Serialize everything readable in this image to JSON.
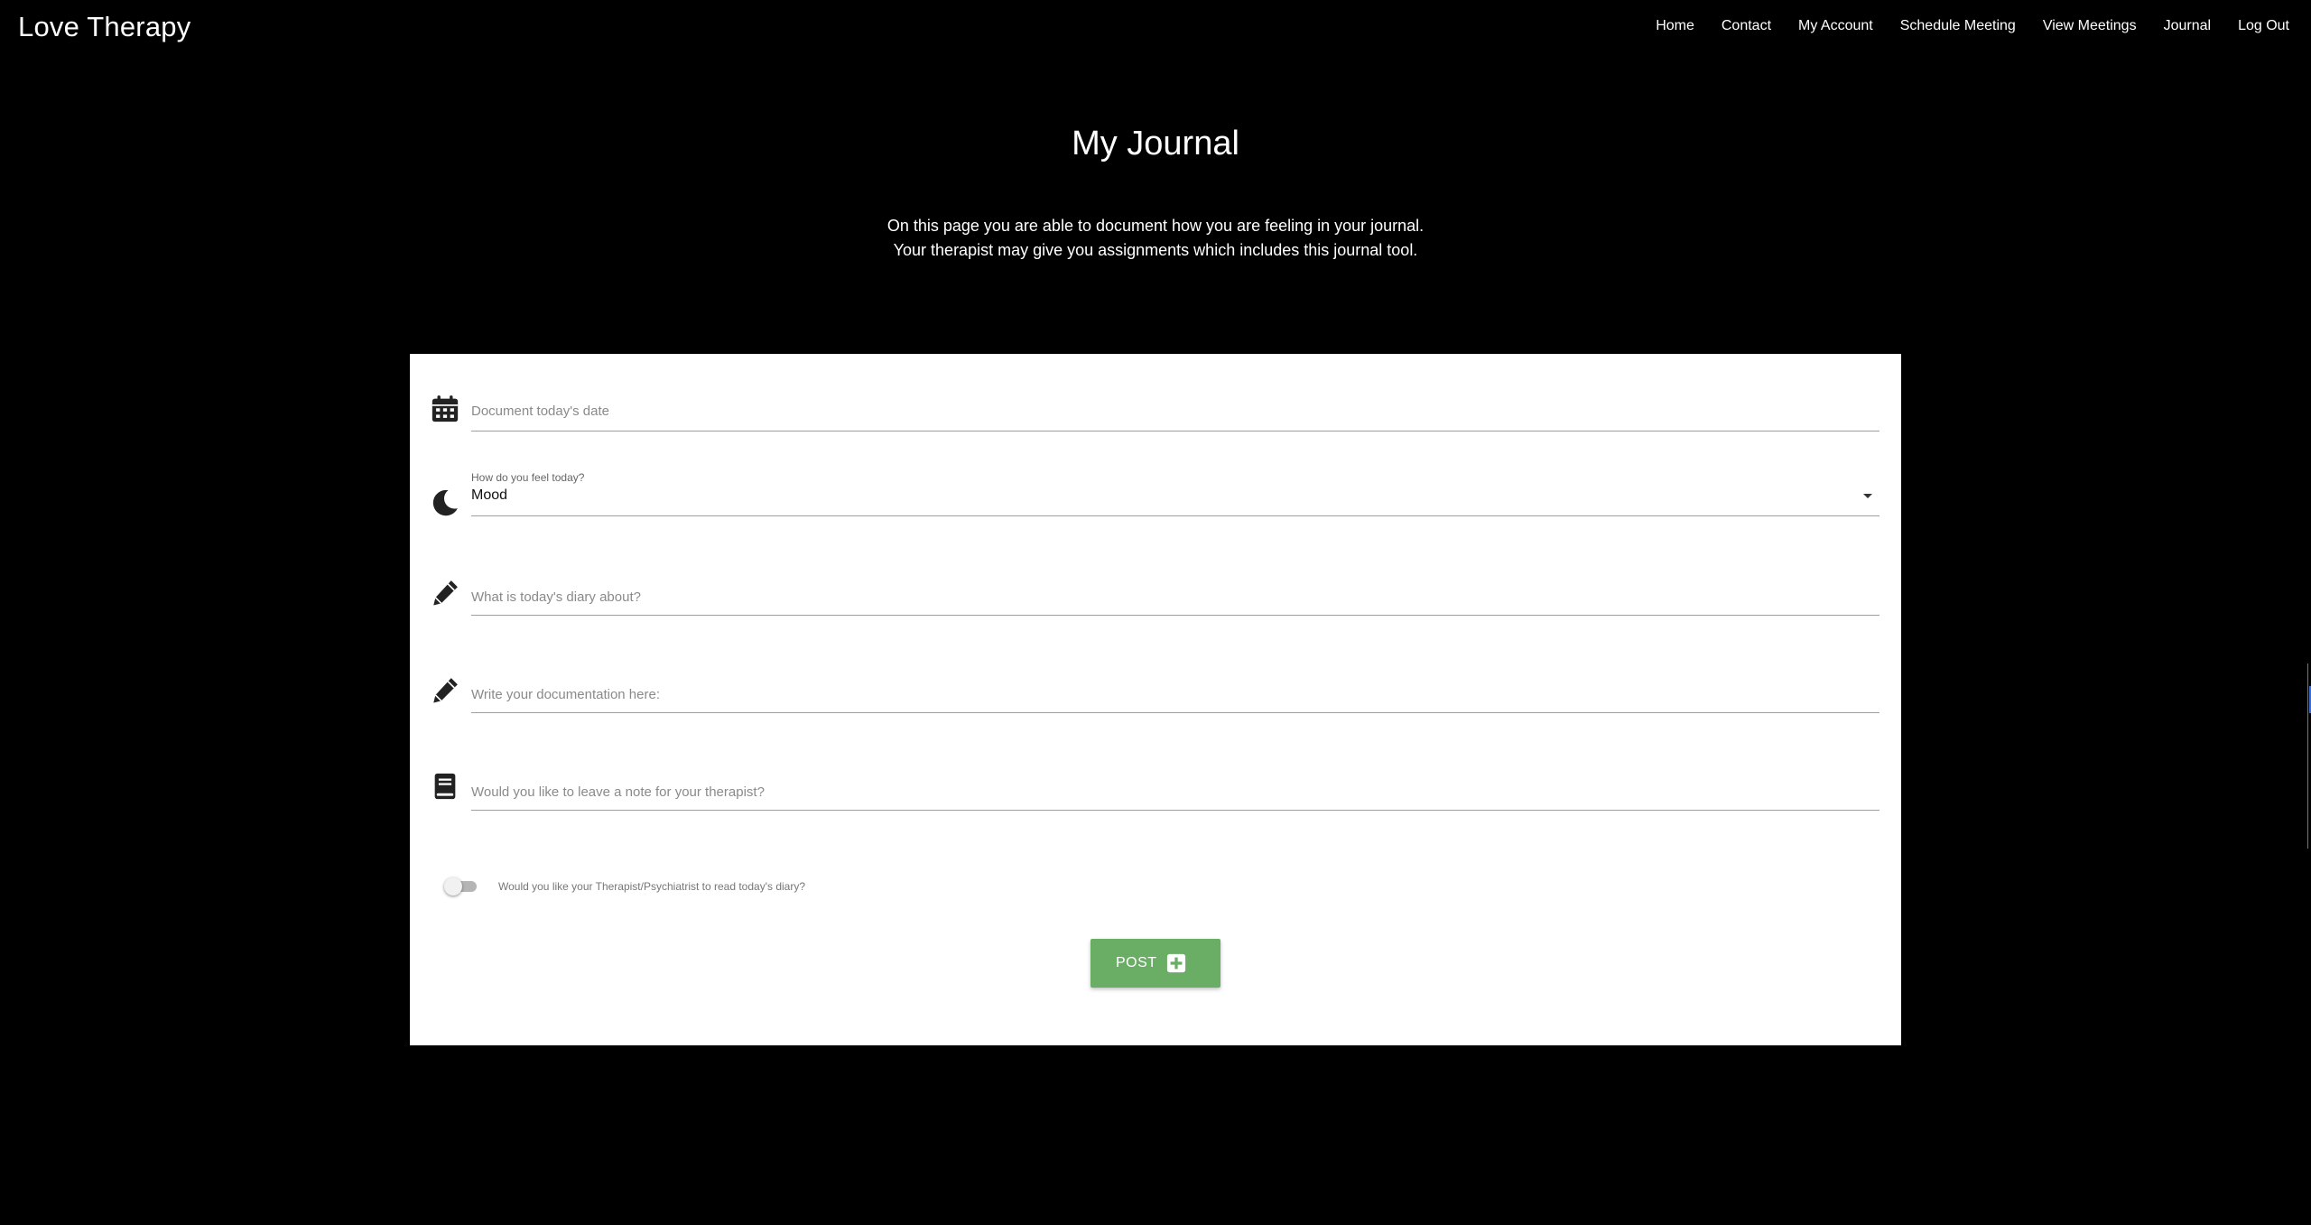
{
  "brand": "Love Therapy",
  "nav": {
    "items": [
      "Home",
      "Contact",
      "My Account",
      "Schedule Meeting",
      "View Meetings",
      "Journal",
      "Log Out"
    ]
  },
  "page": {
    "title": "My Journal",
    "intro_line1": "On this page you are able to document how you are feeling in your journal.",
    "intro_line2": "Your therapist may give you assignments which includes this journal tool."
  },
  "form": {
    "date_placeholder": "Document today's date",
    "mood_label": "How do you feel today?",
    "mood_value": "Mood",
    "topic_placeholder": "What is today's diary about?",
    "documentation_placeholder": "Write your documentation here:",
    "note_placeholder": "Would you like to leave a note for your therapist?",
    "share_toggle_label": "Would you like your Therapist/Psychiatrist to read today's diary?",
    "share_toggle_on": false,
    "post_label": "POST"
  },
  "icons": {
    "date": "calendar-icon",
    "mood": "moon-icon",
    "topic": "pencil-icon",
    "documentation": "pencil-icon",
    "note": "book-icon",
    "post": "plus-square-icon"
  },
  "colors": {
    "page_background": "#000000",
    "card_background": "#ffffff",
    "post_button": "#6aae66"
  }
}
